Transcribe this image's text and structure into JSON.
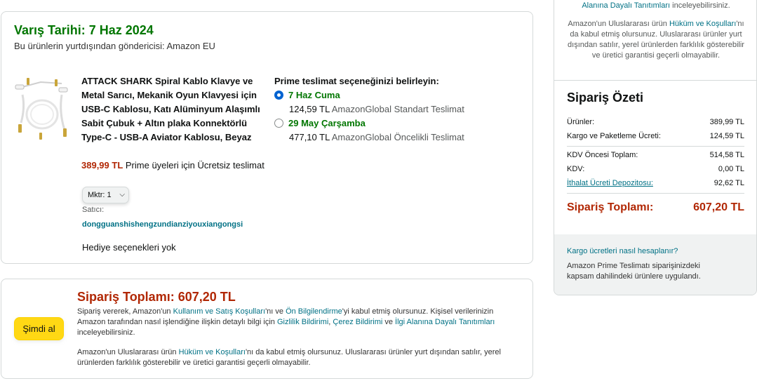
{
  "delivery": {
    "arrival_label": "Varış Tarihi: 7 Haz 2024",
    "shipper": "Bu ürünlerin yurtdışından göndericisi: Amazon EU"
  },
  "product": {
    "image_icon": "usb-c-coiled-cable-product-image",
    "title": "ATTACK SHARK Spiral Kablo Klavye ve Metal Sarıcı, Mekanik Oyun Klavyesi için USB-C Kablosu, Katı Alüminyum Alaşımlı Sabit Çubuk + Altın plaka Konnektörlü Type-C - USB-A Aviator Kablosu, Beyaz",
    "price": "389,99 TL",
    "prime_note": "Prime üyeleri için Ücretsiz teslimat",
    "quantity_label": "Mktr:",
    "quantity_value": "1",
    "seller_label": "Satıcı:",
    "seller_name": "dongguanshishengzundianziyouxiangongsi",
    "gift_options": "Hediye seçenekleri yok"
  },
  "shipping": {
    "title": "Prime teslimat seçeneğinizi belirleyin:",
    "options": [
      {
        "date": "7 Haz Cuma",
        "price": "124,59 TL",
        "method": "AmazonGlobal Standart Teslimat",
        "selected": true
      },
      {
        "date": "29 May Çarşamba",
        "price": "477,10 TL",
        "method": "AmazonGlobal Öncelikli Teslimat",
        "selected": false
      }
    ]
  },
  "order_card": {
    "buy_button": "Şimdi al",
    "total_label": "Sipariş Toplamı:",
    "total_value": "607,20 TL",
    "legal1_pre": "Sipariş vererek, Amazon'un ",
    "legal1_link1": "Kullanım ve Satış Koşulları",
    "legal1_mid1": "'nı ve ",
    "legal1_link2": "Ön Bilgilendirme",
    "legal1_mid2": "'yi kabul etmiş olursunuz. Kişisel verilerinizin Amazon tarafından nasıl işlendiğine ilişkin detaylı bilgi için ",
    "legal1_link3": "Gizlilik Bildirimi",
    "legal1_sep1": ", ",
    "legal1_link4": "Çerez Bildirimi",
    "legal1_sep2": " ve ",
    "legal1_link5": "İlgi Alanına Dayalı Tanıtımları",
    "legal1_post": " inceleyebilirsiniz.",
    "legal2_pre": "Amazon'un Uluslararası ürün ",
    "legal2_link": "Hüküm ve Koşulları",
    "legal2_post": "'nı da kabul etmiş olursunuz. Uluslararası ürünler yurt dışından satılır, yerel ürünlerden farklılık gösterebilir ve üretici garantisi geçerli olmayabilir."
  },
  "sidebar": {
    "top_link": "Alanına Dayalı Tanıtımları",
    "top_post": " inceleyebilirsiniz.",
    "legal2_pre": "Amazon'un Uluslararası ürün ",
    "legal2_link": "Hüküm ve Koşulları",
    "legal2_post": "'nı da kabul etmiş olursunuz. Uluslararası ürünler yurt dışından satılır, yerel ürünlerden farklılık gösterebilir ve üretici garantisi geçerli olmayabilir.",
    "summary_title": "Sipariş Özeti",
    "rows": [
      {
        "label": "Ürünler:",
        "value": "389,99 TL"
      },
      {
        "label": "Kargo ve Paketleme Ücreti:",
        "value": "124,59 TL"
      },
      {
        "label": "KDV Öncesi Toplam:",
        "value": "514,58 TL"
      },
      {
        "label": "KDV:",
        "value": "0,00 TL"
      },
      {
        "label": "İthalat Ücreti Depozitosu:",
        "value": "92,62 TL"
      }
    ],
    "total_label": "Sipariş Toplamı:",
    "total_value": "607,20 TL",
    "shipping_calc_link": "Kargo ücretleri nasıl hesaplanır?",
    "prime_note": "Amazon Prime Teslimatı siparişinizdeki kapsam dahilindeki ürünlere uygulandı."
  },
  "colors": {
    "delivery_green": "#007600",
    "price_red": "#b12704",
    "link_teal": "#007185",
    "buy_button_yellow": "#ffd814",
    "radio_blue": "#0063d1"
  }
}
